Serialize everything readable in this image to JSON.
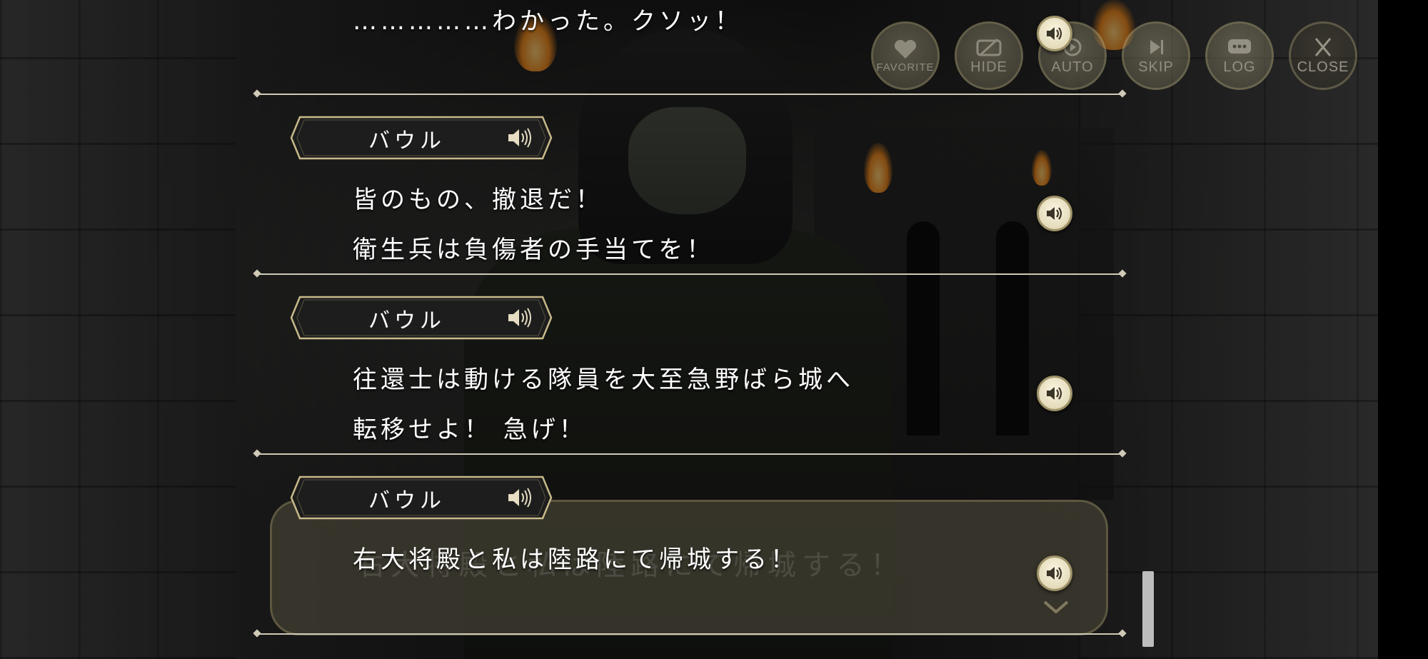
{
  "top_buttons": [
    {
      "key": "favorite",
      "label": "FAVORITE",
      "icon": "heart-icon"
    },
    {
      "key": "hide",
      "label": "HIDE",
      "icon": "hide-icon"
    },
    {
      "key": "auto",
      "label": "AUTO",
      "icon": "auto-play-icon"
    },
    {
      "key": "skip",
      "label": "SKIP",
      "icon": "skip-icon"
    },
    {
      "key": "log",
      "label": "LOG",
      "icon": "chat-log-icon"
    },
    {
      "key": "close",
      "label": "CLOSE",
      "icon": "close-icon"
    }
  ],
  "log": {
    "entries": [
      {
        "speaker": "",
        "lines": [
          "……………わかった。クソッ！"
        ]
      },
      {
        "speaker": "バウル",
        "lines": [
          "皆のもの、撤退だ！",
          "衛生兵は負傷者の手当てを！"
        ]
      },
      {
        "speaker": "バウル",
        "lines": [
          "往還士は動ける隊員を大至急野ばら城へ",
          "転移せよ！ 急げ！"
        ]
      },
      {
        "speaker": "バウル",
        "lines": [
          "右大将殿と私は陸路にて帰城する！"
        ]
      }
    ]
  },
  "message_box": {
    "text": "右大将殿と私は陸路にて帰城する！"
  },
  "colors": {
    "accent_gold": "#c8b98a",
    "nameplate_dark": "#1f1f1f",
    "text": "#ffffff"
  }
}
